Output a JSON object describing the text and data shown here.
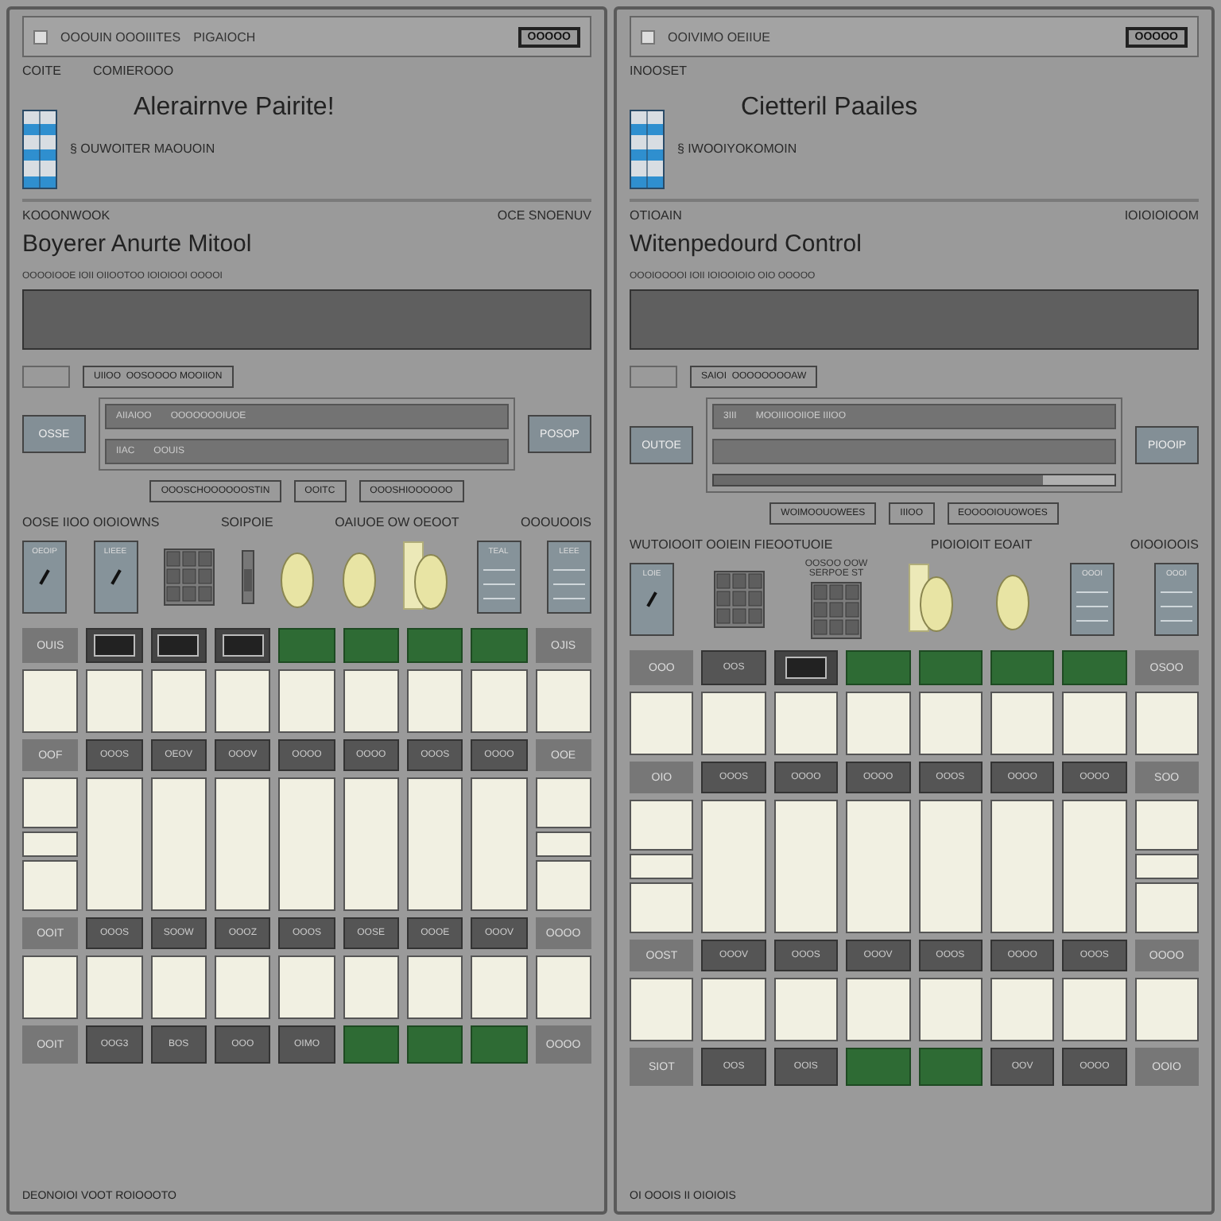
{
  "panels": [
    {
      "title": "OOOUIN OOOIIITES",
      "title_2": "PIGAIOCH",
      "badge": "OOOOO",
      "header_labels": [
        "COITE",
        "COMIEROOO"
      ],
      "heading": "Alerairnve Pairite!",
      "subtitle": "§ OUWOITER MAOUOIN",
      "section_label": "KOOONWOOK",
      "section_right": "OCE SNOENUV",
      "section_heading": "Boyerer Anurte Mitool",
      "display_caption": "OOOOIOOE IOII OIIOOTOO IOIOIOOI OOOOI",
      "tag": {
        "label": "UIIOO",
        "value": "OOSOOOO MOOIION"
      },
      "left_button": "OSSE",
      "right_button": "POSOP",
      "fields": [
        {
          "label": "AIIAIOO",
          "value": "OOOOOOOIUOE"
        },
        {
          "label": "IIAC",
          "value": "OOUIS"
        }
      ],
      "bottom_tags": [
        "OOOSCHOOOOOOSTIN",
        "OOITC",
        "OOOSHIOOOOOO"
      ],
      "control_labels": [
        "OOSE IIOO OIOIOWNS",
        "SOIPOIE",
        "OAIUOE OW OEOOT",
        "OOOUOOIS"
      ],
      "devices": [
        {
          "kind": "panel",
          "text": "OEOIP"
        },
        {
          "kind": "panel",
          "text": "LIEEE"
        },
        {
          "kind": "keypad"
        },
        {
          "kind": "switch"
        },
        {
          "kind": "knob"
        },
        {
          "kind": "knob"
        },
        {
          "kind": "knob-block"
        },
        {
          "kind": "meter",
          "text": "TEAL"
        },
        {
          "kind": "meter",
          "text": "LEEE"
        }
      ],
      "grid": [
        [
          {
            "kind": "label",
            "text": "OUIS"
          },
          {
            "kind": "screen"
          },
          {
            "kind": "screen"
          },
          {
            "kind": "screen"
          },
          {
            "kind": "key",
            "lit": true
          },
          {
            "kind": "key",
            "lit": true
          },
          {
            "kind": "key",
            "lit": true
          },
          {
            "kind": "key",
            "lit": true
          },
          {
            "kind": "label",
            "text": "OJIS"
          }
        ],
        [
          {
            "kind": "pad"
          },
          {
            "kind": "pad"
          },
          {
            "kind": "pad"
          },
          {
            "kind": "pad"
          },
          {
            "kind": "pad"
          },
          {
            "kind": "pad"
          },
          {
            "kind": "pad"
          },
          {
            "kind": "pad"
          },
          {
            "kind": "pad"
          }
        ],
        [
          {
            "kind": "label",
            "text": "OOF"
          },
          {
            "kind": "key",
            "lit": false,
            "text": "OOOS"
          },
          {
            "kind": "key",
            "lit": false,
            "text": "OEOV"
          },
          {
            "kind": "key",
            "lit": false,
            "text": "OOOV"
          },
          {
            "kind": "key",
            "lit": false,
            "text": "OOOO"
          },
          {
            "kind": "key",
            "lit": false,
            "text": "OOOO"
          },
          {
            "kind": "key",
            "lit": false,
            "text": "OOOS"
          },
          {
            "kind": "key",
            "lit": false,
            "text": "OOOO"
          },
          {
            "kind": "label",
            "text": "OOE"
          }
        ],
        [
          {
            "kind": "stack"
          },
          {
            "kind": "tall"
          },
          {
            "kind": "tall"
          },
          {
            "kind": "tall"
          },
          {
            "kind": "tall"
          },
          {
            "kind": "tall"
          },
          {
            "kind": "tall"
          },
          {
            "kind": "tall"
          },
          {
            "kind": "stack"
          }
        ],
        [
          {
            "kind": "label",
            "text": "OOIT"
          },
          {
            "kind": "key",
            "lit": false,
            "text": "OOOS"
          },
          {
            "kind": "key",
            "lit": false,
            "text": "SOOW"
          },
          {
            "kind": "key",
            "lit": false,
            "text": "OOOZ"
          },
          {
            "kind": "key",
            "lit": false,
            "text": "OOOS"
          },
          {
            "kind": "key",
            "lit": false,
            "text": "OOSE"
          },
          {
            "kind": "key",
            "lit": false,
            "text": "OOOE"
          },
          {
            "kind": "key",
            "lit": false,
            "text": "OOOV"
          },
          {
            "kind": "label",
            "text": "OOOO"
          }
        ],
        [
          {
            "kind": "pad"
          },
          {
            "kind": "pad"
          },
          {
            "kind": "pad"
          },
          {
            "kind": "pad"
          },
          {
            "kind": "pad"
          },
          {
            "kind": "pad"
          },
          {
            "kind": "pad"
          },
          {
            "kind": "pad"
          },
          {
            "kind": "pad"
          }
        ],
        [
          {
            "kind": "label",
            "text": "OOIT"
          },
          {
            "kind": "key",
            "lit": false,
            "text": "OOG3"
          },
          {
            "kind": "key",
            "lit": false,
            "text": "BOS"
          },
          {
            "kind": "key",
            "lit": false,
            "text": "OOO"
          },
          {
            "kind": "key",
            "lit": false,
            "text": "OIMO"
          },
          {
            "kind": "key",
            "lit": true
          },
          {
            "kind": "key",
            "lit": true
          },
          {
            "kind": "key",
            "lit": true
          },
          {
            "kind": "label",
            "text": "OOOO"
          }
        ]
      ],
      "footer": "DEONOIOI VOOT ROIOOOTO"
    },
    {
      "title": "OOIVIMO OEIIUE",
      "badge": "OOOOO",
      "header_labels": [
        "INOOSET"
      ],
      "heading": "Cietteril Paailes",
      "subtitle": "§ IWOOIYOKOMOIN",
      "section_label": "OTIOAIN",
      "section_right": "IOIOIOIOOM",
      "section_heading": "Witenpedourd Control",
      "display_caption": "OOOIOOOOI IOII IOIOOIOIO OIO OOOOO",
      "tag": {
        "label": "SAIOI",
        "value": "OOOOOOOOAW"
      },
      "left_button": "OUTOE",
      "right_button": "PIOOIP",
      "fields": [
        {
          "label": "3III",
          "value": "MOOIIIOOIIOE IIIOO"
        }
      ],
      "blank_bar": true,
      "slider": {
        "level": 0.82
      },
      "bottom_tags": [
        "WOIMOOUOWEES",
        "IIIOO",
        "EOOOOIOUOWOES"
      ],
      "control_labels": [
        "WUTOIOOIT OOIEIN FIEOOTUOIE",
        "PIOIOIOIT EOAIT",
        "OIOOIOOIS"
      ],
      "devices": [
        {
          "kind": "panel",
          "text": "LOIE"
        },
        {
          "kind": "keypad"
        },
        {
          "kind": "keypad",
          "text": "OOSOO OOW SERPOE ST"
        },
        {
          "kind": "knob-block"
        },
        {
          "kind": "knob"
        },
        {
          "kind": "meter",
          "text": "OOOI"
        },
        {
          "kind": "meter",
          "text": "OOOI"
        }
      ],
      "grid": [
        [
          {
            "kind": "label",
            "text": "OOO"
          },
          {
            "kind": "key",
            "lit": false,
            "text": "OOS"
          },
          {
            "kind": "screen"
          },
          {
            "kind": "key",
            "lit": true
          },
          {
            "kind": "key",
            "lit": true
          },
          {
            "kind": "key",
            "lit": true
          },
          {
            "kind": "key",
            "lit": true
          },
          {
            "kind": "label",
            "text": "OSOO"
          }
        ],
        [
          {
            "kind": "pad"
          },
          {
            "kind": "pad"
          },
          {
            "kind": "pad"
          },
          {
            "kind": "pad"
          },
          {
            "kind": "pad"
          },
          {
            "kind": "pad"
          },
          {
            "kind": "pad"
          },
          {
            "kind": "pad"
          }
        ],
        [
          {
            "kind": "label",
            "text": "OIO"
          },
          {
            "kind": "key",
            "lit": false,
            "text": "OOOS"
          },
          {
            "kind": "key",
            "lit": false,
            "text": "OOOO"
          },
          {
            "kind": "key",
            "lit": false,
            "text": "OOOO"
          },
          {
            "kind": "key",
            "lit": false,
            "text": "OOOS"
          },
          {
            "kind": "key",
            "lit": false,
            "text": "OOOO"
          },
          {
            "kind": "key",
            "lit": false,
            "text": "OOOO"
          },
          {
            "kind": "label",
            "text": "SOO"
          }
        ],
        [
          {
            "kind": "stack"
          },
          {
            "kind": "tall"
          },
          {
            "kind": "tall"
          },
          {
            "kind": "tall"
          },
          {
            "kind": "tall"
          },
          {
            "kind": "tall"
          },
          {
            "kind": "tall"
          },
          {
            "kind": "stack"
          }
        ],
        [
          {
            "kind": "label",
            "text": "OOST"
          },
          {
            "kind": "key",
            "lit": false,
            "text": "OOOV"
          },
          {
            "kind": "key",
            "lit": false,
            "text": "OOOS"
          },
          {
            "kind": "key",
            "lit": false,
            "text": "OOOV"
          },
          {
            "kind": "key",
            "lit": false,
            "text": "OOOS"
          },
          {
            "kind": "key",
            "lit": false,
            "text": "OOOO"
          },
          {
            "kind": "key",
            "lit": false,
            "text": "OOOS"
          },
          {
            "kind": "label",
            "text": "OOOO"
          }
        ],
        [
          {
            "kind": "pad"
          },
          {
            "kind": "pad"
          },
          {
            "kind": "pad"
          },
          {
            "kind": "pad"
          },
          {
            "kind": "pad"
          },
          {
            "kind": "pad"
          },
          {
            "kind": "pad"
          },
          {
            "kind": "pad"
          }
        ],
        [
          {
            "kind": "label",
            "text": "SIOT"
          },
          {
            "kind": "key",
            "lit": false,
            "text": "OOS"
          },
          {
            "kind": "key",
            "lit": false,
            "text": "OOIS"
          },
          {
            "kind": "key",
            "lit": true
          },
          {
            "kind": "key",
            "lit": true
          },
          {
            "kind": "key",
            "lit": false,
            "text": "OOV"
          },
          {
            "kind": "key",
            "lit": false,
            "text": "OOOO"
          },
          {
            "kind": "label",
            "text": "OOIO"
          }
        ]
      ],
      "footer": "OI OOOIS II OIOIOIS"
    }
  ]
}
